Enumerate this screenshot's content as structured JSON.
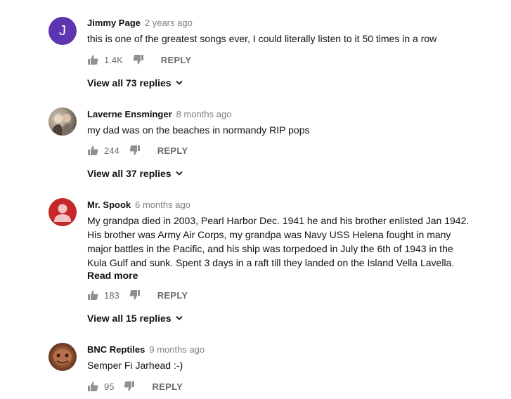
{
  "comments": [
    {
      "author": "Jimmy Page",
      "time": "2 years ago",
      "avatar_letter": "J",
      "text": "this is one of the greatest songs ever, I could literally listen to it 50 times in a row",
      "likes": "1.4K",
      "reply_label": "REPLY",
      "view_replies": "View all 73 replies"
    },
    {
      "author": "Laverne Ensminger",
      "time": "8 months ago",
      "text": "my dad was  on the beaches in normandy RIP  pops",
      "likes": "244",
      "reply_label": "REPLY",
      "view_replies": "View all 37 replies"
    },
    {
      "author": "Mr. Spook",
      "time": "6 months ago",
      "text": "My grandpa died in 2003, Pearl Harbor Dec. 1941 he and his brother enlisted Jan 1942. His brother was Army Air Corps, my grandpa was Navy USS Helena fought in many major battles in the Pacific, and his ship was torpedoed in July the 6th of 1943 in the Kula Gulf and sunk. Spent 3 days in a raft till they landed on the Island Vella Lavella.",
      "read_more": "Read more",
      "likes": "183",
      "reply_label": "REPLY",
      "view_replies": "View all 15 replies"
    },
    {
      "author": "BNC Reptiles",
      "time": "9 months ago",
      "text": "Semper Fi Jarhead :-)",
      "likes": "95",
      "reply_label": "REPLY"
    }
  ],
  "colors": {
    "avatar_j": "#5e35b1",
    "avatar_spook": "#c62828",
    "meta_gray": "#808080",
    "icon_gray": "#6b6b6b"
  },
  "icons": [
    "thumbs-up-icon",
    "thumbs-down-icon",
    "chevron-down-icon",
    "user-silhouette-icon"
  ]
}
